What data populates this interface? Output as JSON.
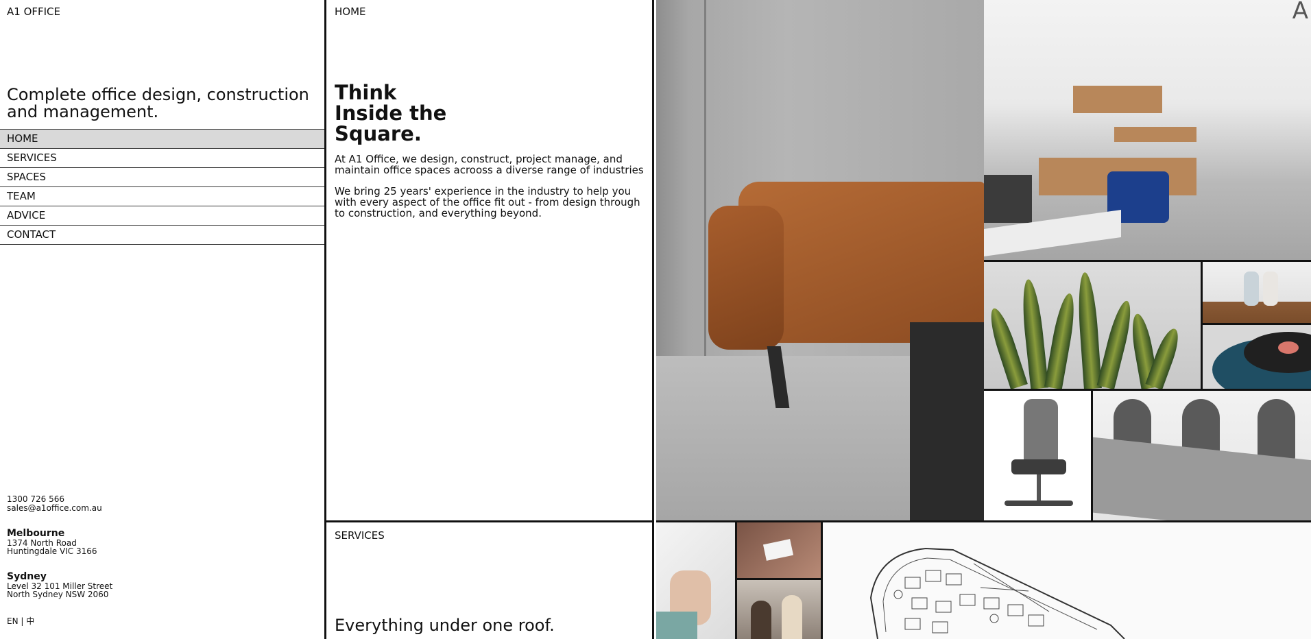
{
  "sidebar": {
    "brand": "A1 OFFICE",
    "tagline": "Complete office design, construction and management.",
    "nav": [
      {
        "label": "HOME",
        "active": true
      },
      {
        "label": "SERVICES"
      },
      {
        "label": "SPACES"
      },
      {
        "label": "TEAM"
      },
      {
        "label": "ADVICE"
      },
      {
        "label": "CONTACT"
      }
    ],
    "phone": "1300 726 566",
    "email": "sales@a1office.com.au",
    "offices": [
      {
        "city": "Melbourne",
        "line1": "1374 North Road",
        "line2": "Huntingdale VIC 3166"
      },
      {
        "city": "Sydney",
        "line1": "Level 32 101 Miller Street",
        "line2": "North Sydney NSW 2060"
      }
    ],
    "language": "EN | 中"
  },
  "home": {
    "label": "HOME",
    "headline": [
      "Think",
      "Inside the",
      "Square."
    ],
    "para1": "At A1 Office, we design, construct, project manage, and maintain office spaces acrooss a diverse range of industries",
    "para2": "We bring 25 years' experience in the industry to help you with every aspect of the office fit out - from design through to construction, and everything beyond."
  },
  "services": {
    "label": "SERVICES",
    "title": "Everything under one roof."
  },
  "gallery": {
    "images": [
      "leather-armchair-photo",
      "office-interior-photo",
      "snake-plant-photo",
      "vases-photo",
      "teal-stool-photo",
      "office-chair-photo",
      "meeting-room-chairs-photo",
      "hands-signing-photo",
      "business-card-photo",
      "team-meeting-photo",
      "floor-plan-drawing"
    ],
    "office_logo_glyph": "A"
  }
}
